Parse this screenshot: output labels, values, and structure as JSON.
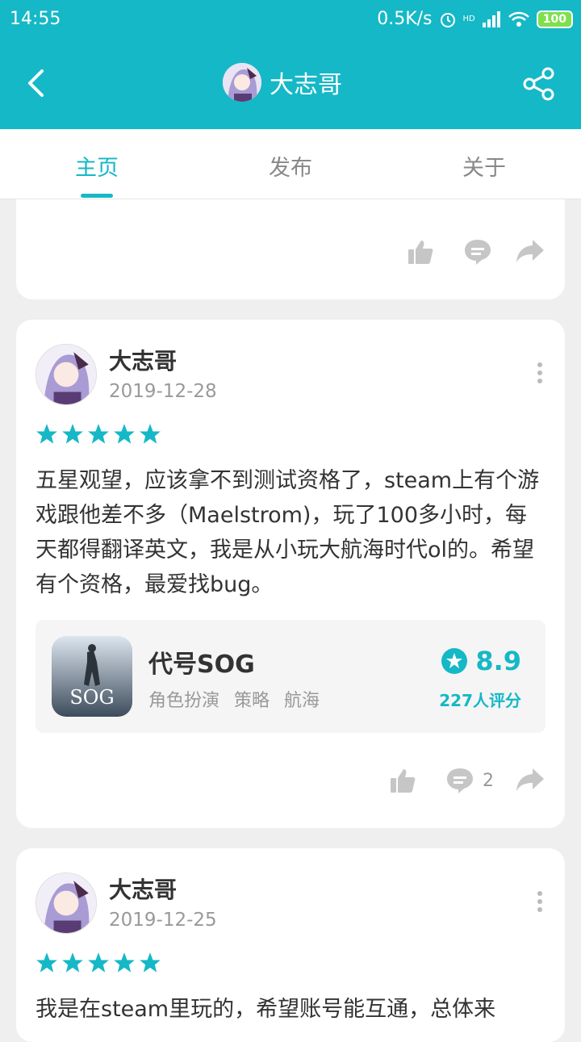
{
  "status": {
    "time": "14:55",
    "speed": "0.5K/s",
    "network": "HD",
    "battery": "100"
  },
  "appbar": {
    "title": "大志哥"
  },
  "tabs": [
    {
      "label": "主页"
    },
    {
      "label": "发布"
    },
    {
      "label": "关于"
    }
  ],
  "posts": [
    {
      "user": "大志哥",
      "date": "2019-12-28",
      "stars": 5,
      "text": "五星观望，应该拿不到测试资格了，steam上有个游戏跟他差不多（Maelstrom)，玩了100多小时，每天都得翻译英文，我是从小玩大航海时代ol的。希望有个资格，最爱找bug。",
      "game": {
        "name": "代号SOG",
        "tags": [
          "角色扮演",
          "策略",
          "航海"
        ],
        "score": "8.9",
        "rating_count": "227人评分",
        "icon_text": "SOG"
      },
      "comments": "2"
    },
    {
      "user": "大志哥",
      "date": "2019-12-25",
      "stars": 5,
      "text": "我是在steam里玩的，希望账号能互通，总体来"
    }
  ],
  "colors": {
    "accent": "#15b8c6",
    "icon_gray": "#c6c6c6"
  }
}
